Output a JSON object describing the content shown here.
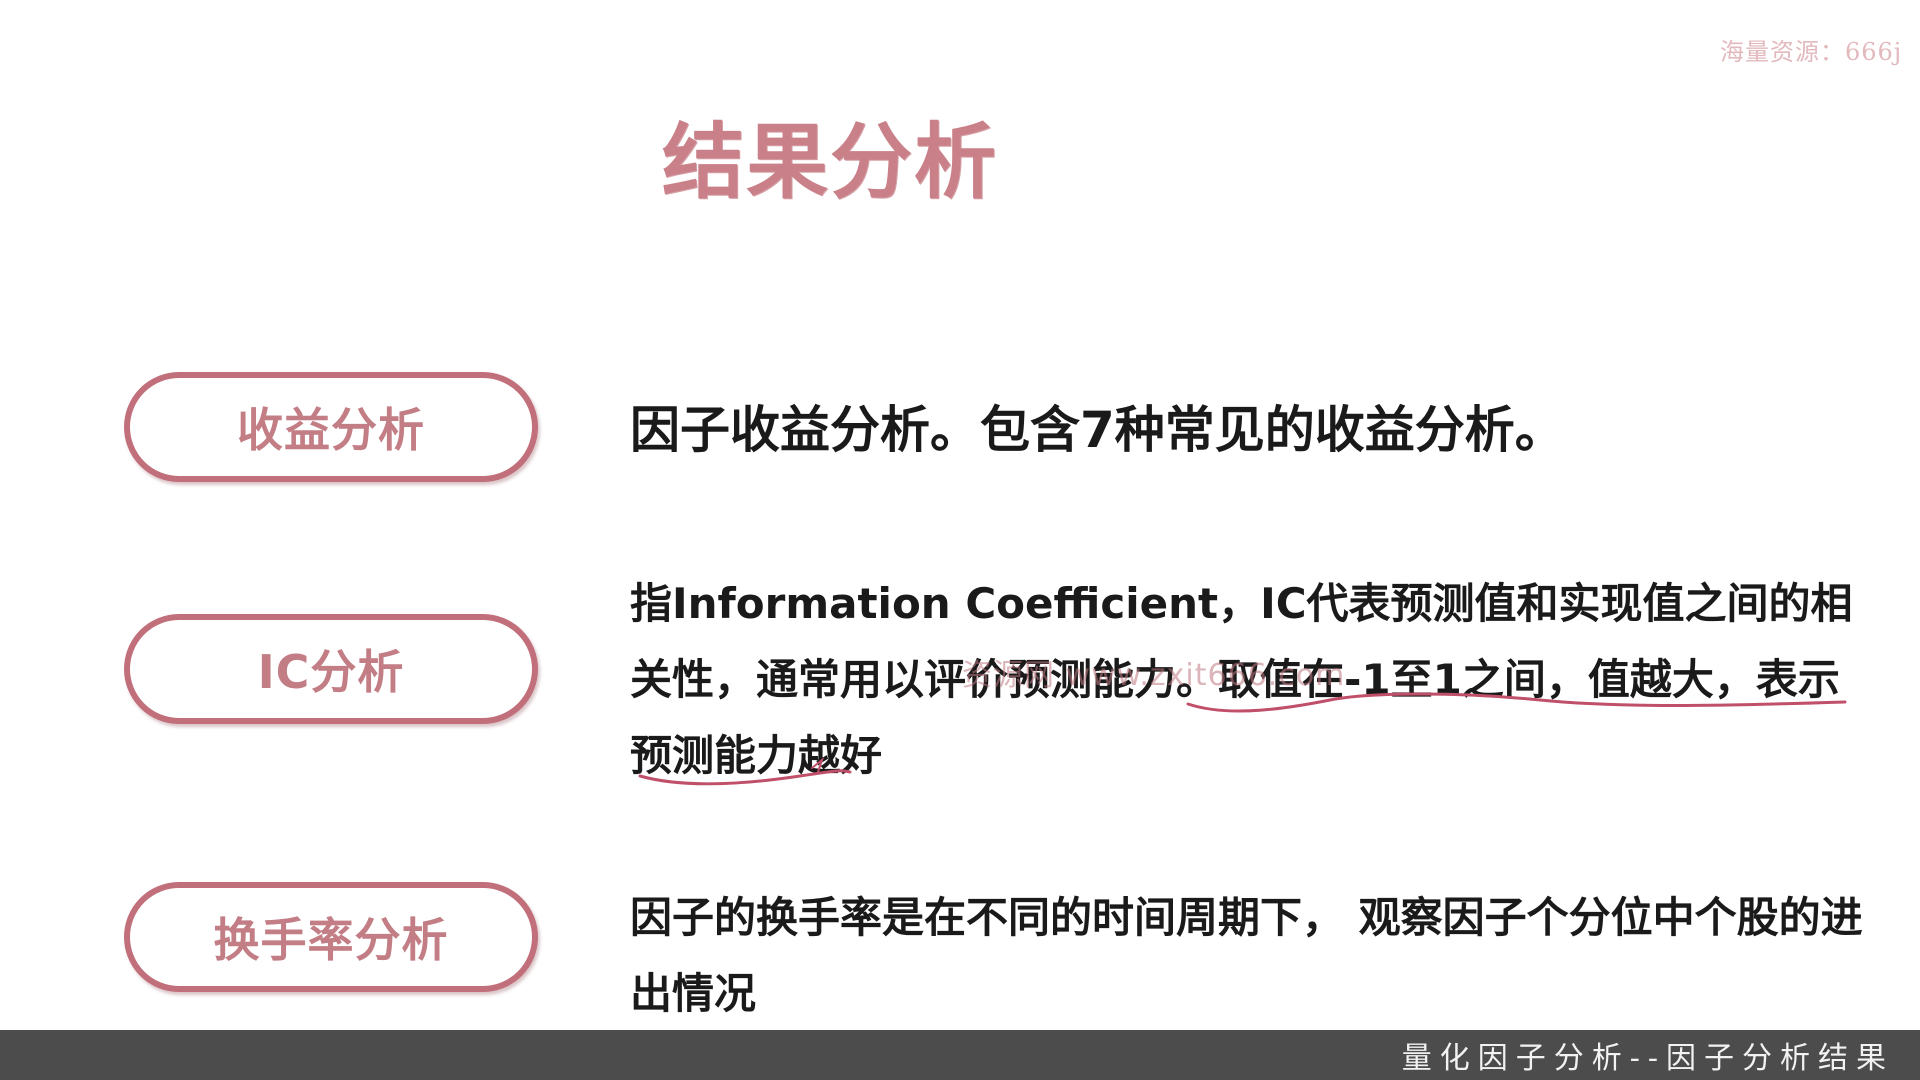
{
  "watermark_top": "海量资源：666j",
  "title": "结果分析",
  "sections": [
    {
      "label": "收益分析",
      "description": "因子收益分析。包含7种常见的收益分析。"
    },
    {
      "label": "IC分析",
      "description": "指Information Coefficient，IC代表预测值和实现值之间的相关性，通常用以评价预测能力。取值在-1至1之间，值越大，表示预测能力越好"
    },
    {
      "label": "换手率分析",
      "description": "因子的换手率是在不同的时间周期下， 观察因子个分位中个股的进出情况"
    }
  ],
  "overlay_watermark": "资源网 www.zxit666.com",
  "footer_caption": "量化因子分析--因子分析结果",
  "colors": {
    "accent": "#c16f7a",
    "title": "#c98088",
    "annotation": "#c0506a",
    "footer_bg": "#4c4c4c"
  }
}
